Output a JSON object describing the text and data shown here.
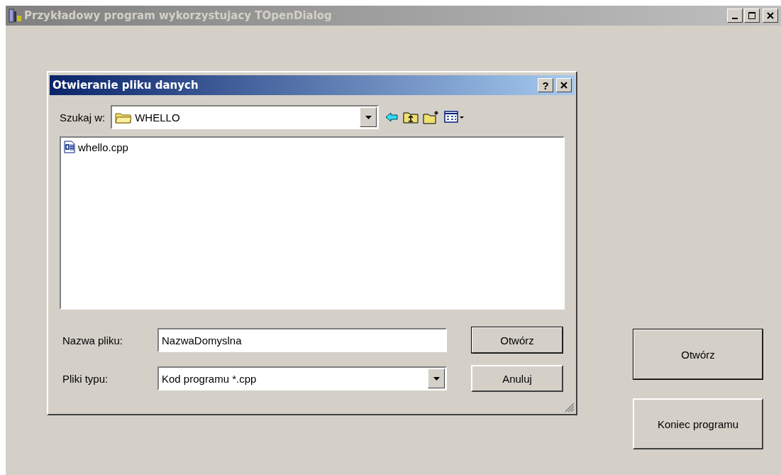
{
  "window": {
    "title": "Przykładowy program wykorzystujacy TOpenDialog",
    "active": false,
    "controls": [
      {
        "kind": "minimize"
      },
      {
        "kind": "maximize"
      },
      {
        "kind": "close"
      }
    ]
  },
  "dialog": {
    "title": "Otwieranie pliku danych",
    "active": true,
    "help_label": "?",
    "look_in": {
      "label": "Szukaj w:",
      "value": "WHELLO"
    },
    "toolbar": [
      {
        "kind": "back"
      },
      {
        "kind": "up"
      },
      {
        "kind": "new-folder"
      },
      {
        "kind": "view-menu"
      }
    ],
    "files": [
      {
        "name": "whello.cpp"
      }
    ],
    "file_name": {
      "label": "Nazwa pliku:",
      "value": "NazwaDomyslna"
    },
    "file_type": {
      "label": "Pliki typu:",
      "value": "Kod programu *.cpp"
    },
    "buttons": [
      {
        "label": "Otwórz",
        "default": true
      },
      {
        "label": "Anuluj",
        "default": false
      }
    ]
  },
  "main_buttons": [
    {
      "label": "Otwórz",
      "default": true
    },
    {
      "label": "Koniec programu",
      "default": false
    }
  ]
}
